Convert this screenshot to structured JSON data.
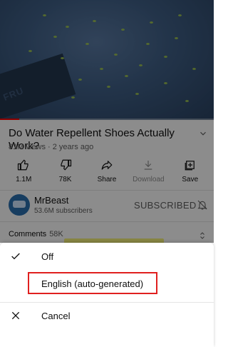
{
  "video": {
    "brand_text": "FRU",
    "progress_fraction": 0.09
  },
  "title": "Do Water Repellent Shoes Actually Work?",
  "meta": "81M views · 2 years ago",
  "actions": [
    {
      "name": "like",
      "label": "1.1M",
      "disabled": false
    },
    {
      "name": "dislike",
      "label": "78K",
      "disabled": false
    },
    {
      "name": "share",
      "label": "Share",
      "disabled": false
    },
    {
      "name": "download",
      "label": "Download",
      "disabled": true
    },
    {
      "name": "save",
      "label": "Save",
      "disabled": false
    }
  ],
  "channel": {
    "name": "MrBeast",
    "subscribers": "53.6M subscribers",
    "subscribe_state": "SUBSCRIBED"
  },
  "comments": {
    "label": "Comments",
    "count": "58K"
  },
  "captions_sheet": {
    "items": [
      {
        "label": "Off",
        "icon": "check-icon"
      },
      {
        "label": "English (auto-generated)",
        "icon": ""
      },
      {
        "label": "Cancel",
        "icon": "close-icon"
      }
    ]
  },
  "colors": {
    "highlight": "#e0201f",
    "progress": "#ff0000"
  }
}
